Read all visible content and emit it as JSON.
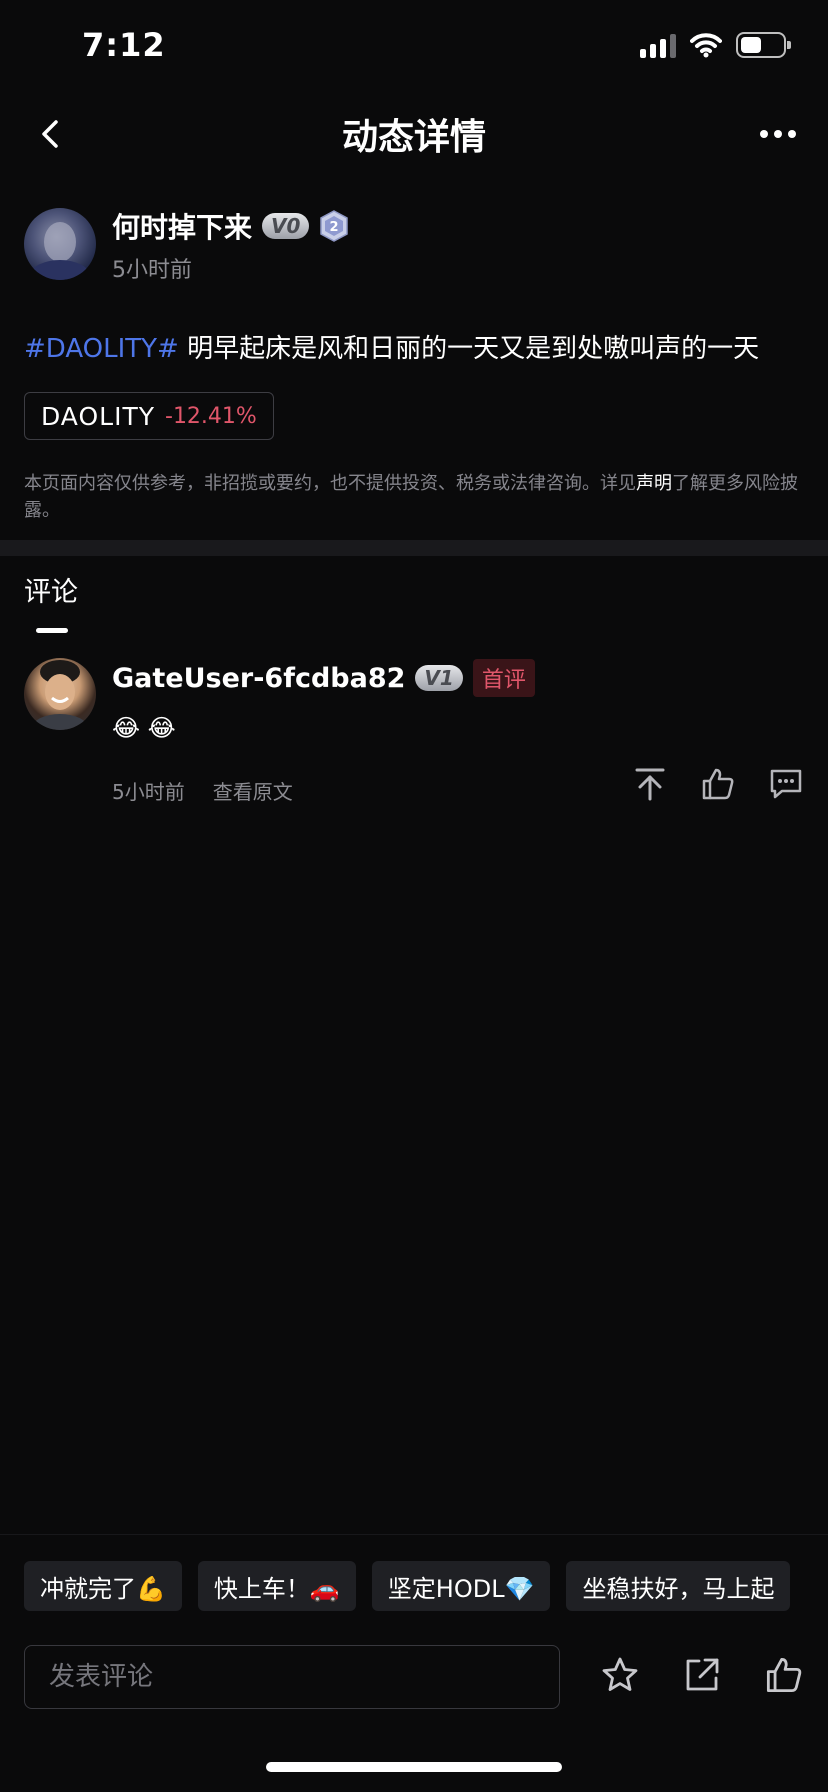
{
  "status_bar": {
    "time": "7:12",
    "battery_level": 0.5
  },
  "nav": {
    "title": "动态详情"
  },
  "post": {
    "author": "何时掉下来",
    "vip_level": "V0",
    "level_badge": "2",
    "time": "5小时前",
    "hashtag": "#DAOLITY#",
    "content": " 明早起床是风和日丽的一天又是到处嗷叫声的一天",
    "token": {
      "name": "DAOLITY",
      "change": "-12.41%"
    },
    "disclaimer": {
      "text_before": "本页面内容仅供参考，非招揽或要约，也不提供投资、税务或法律咨询。详见",
      "link": "声明",
      "text_after": "了解更多风险披露。"
    }
  },
  "comments_section": {
    "tab_label": "评论",
    "comments": [
      {
        "user": "GateUser-6fcdba82",
        "vip_level": "V1",
        "badge": "首评",
        "text": "😂 😂",
        "time": "5小时前",
        "view_original": "查看原文"
      }
    ]
  },
  "bottom": {
    "quick_replies": [
      "冲就完了💪",
      "快上车！🚗",
      "坚定HODL💎",
      "坐稳扶好，马上起"
    ],
    "input_placeholder": "发表评论"
  },
  "colors": {
    "accent_blue": "#4e76e9",
    "negative_red": "#e0566a",
    "background": "#0a0a0b"
  },
  "icons": [
    "back-icon",
    "more-icon",
    "pin-top-icon",
    "thumbs-up-icon",
    "reply-icon",
    "star-icon",
    "share-icon"
  ]
}
